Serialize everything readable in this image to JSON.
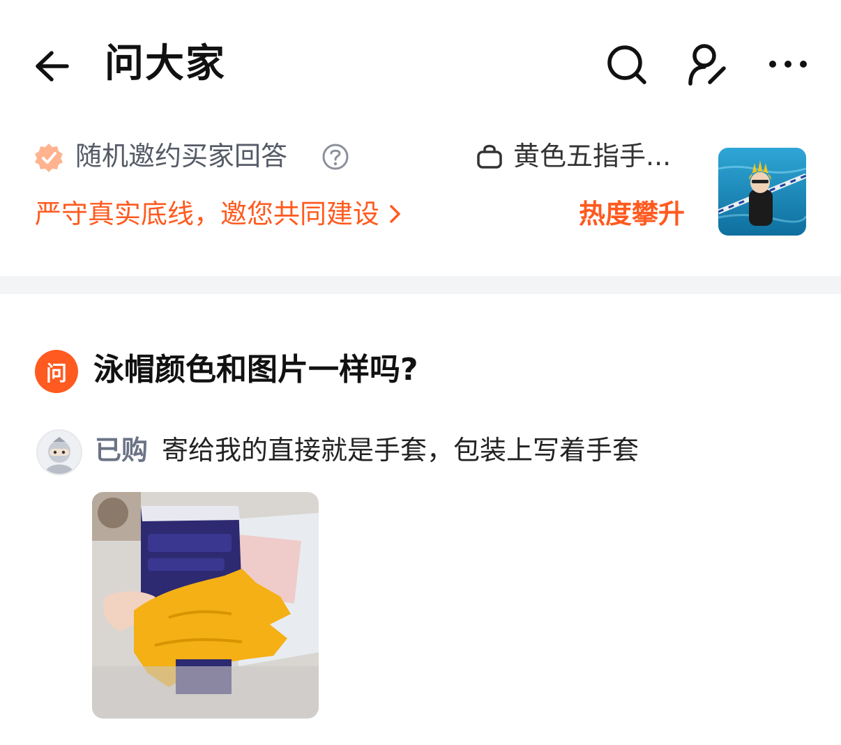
{
  "header": {
    "title": "问大家",
    "icons": [
      "back-arrow-icon",
      "search-icon",
      "user-edit-icon",
      "more-icon"
    ]
  },
  "info": {
    "invite_label": "随机邀约买家回答",
    "product_name": "黄色五指手...",
    "slogan": "严守真实底线，邀您共同建设",
    "hot_label": "热度攀升"
  },
  "question": {
    "badge": "问",
    "text": "泳帽颜色和图片一样吗?"
  },
  "answer": {
    "tag": "已购",
    "text": "寄给我的直接就是手套，包装上写着手套"
  },
  "colors": {
    "accent": "#ff5a1f",
    "muted_text": "#6b7385",
    "divider": "#f3f4f6"
  }
}
